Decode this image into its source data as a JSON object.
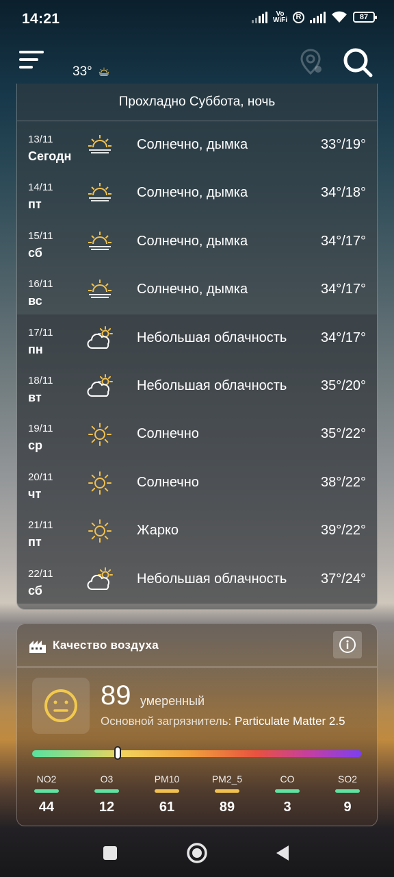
{
  "status_bar": {
    "time": "14:21",
    "vowifi_top": "Vo",
    "vowifi_bottom": "WiFi",
    "r_badge": "R",
    "battery": "87"
  },
  "header": {
    "current_temp": "33°",
    "icons": {
      "menu": "hamburger-icon",
      "location": "location-pin-icon",
      "search": "search-icon",
      "weather": "sun-haze-icon"
    }
  },
  "forecast": {
    "header": "Прохладно Суббота, ночь",
    "days": [
      {
        "date": "13/11",
        "day": "Сегодн",
        "icon": "sun-haze",
        "condition": "Солнечно, дымка",
        "temps": "33°/19°"
      },
      {
        "date": "14/11",
        "day": "пт",
        "icon": "sun-haze",
        "condition": "Солнечно, дымка",
        "temps": "34°/18°"
      },
      {
        "date": "15/11",
        "day": "сб",
        "icon": "sun-haze",
        "condition": "Солнечно, дымка",
        "temps": "34°/17°"
      },
      {
        "date": "16/11",
        "day": "вс",
        "icon": "sun-haze",
        "condition": "Солнечно, дымка",
        "temps": "34°/17°"
      },
      {
        "date": "17/11",
        "day": "пн",
        "icon": "partly-cloudy",
        "condition": "Небольшая облачность",
        "temps": "34°/17°"
      },
      {
        "date": "18/11",
        "day": "вт",
        "icon": "partly-cloudy",
        "condition": "Небольшая облачность",
        "temps": "35°/20°"
      },
      {
        "date": "19/11",
        "day": "ср",
        "icon": "sunny",
        "condition": "Солнечно",
        "temps": "35°/22°"
      },
      {
        "date": "20/11",
        "day": "чт",
        "icon": "sunny",
        "condition": "Солнечно",
        "temps": "38°/22°"
      },
      {
        "date": "21/11",
        "day": "пт",
        "icon": "sunny",
        "condition": "Жарко",
        "temps": "39°/22°"
      },
      {
        "date": "22/11",
        "day": "сб",
        "icon": "partly-cloudy",
        "condition": "Небольшая облачность",
        "temps": "37°/24°"
      }
    ]
  },
  "air_quality": {
    "title": "Качество воздуха",
    "aqi": "89",
    "level": "умеренный",
    "pollutant_label": "Основной загрязнитель:",
    "pollutant_value": "Particulate Matter 2.5",
    "aqi_bar_fraction": 0.26,
    "pollutants": [
      {
        "name": "NO2",
        "value": "44",
        "color": "#5ee3a1"
      },
      {
        "name": "O3",
        "value": "12",
        "color": "#5ee3a1"
      },
      {
        "name": "PM10",
        "value": "61",
        "color": "#f2c14e"
      },
      {
        "name": "PM2_5",
        "value": "89",
        "color": "#f2c14e"
      },
      {
        "name": "CO",
        "value": "3",
        "color": "#5ee3a1"
      },
      {
        "name": "SO2",
        "value": "9",
        "color": "#5ee3a1"
      }
    ],
    "colors": {
      "face": "#f2c94c"
    }
  },
  "nav": {
    "icons": [
      "recents-square-icon",
      "home-circle-icon",
      "back-triangle-icon"
    ]
  }
}
